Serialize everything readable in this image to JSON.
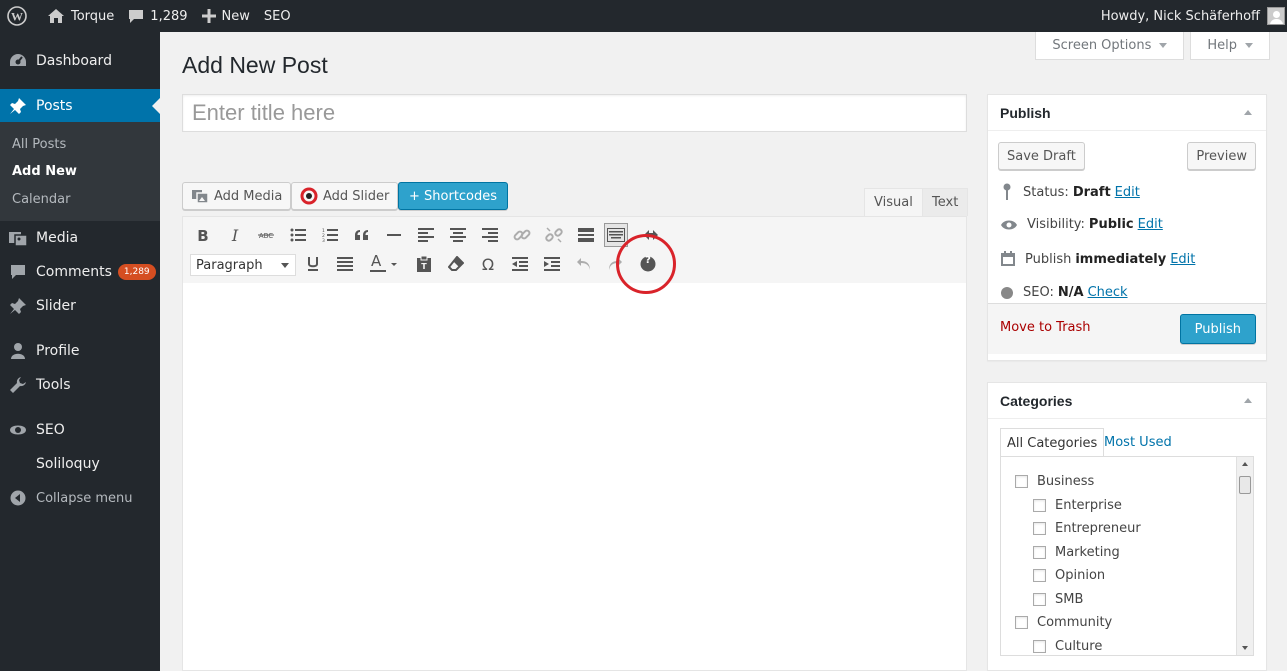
{
  "admin_bar": {
    "site_name": "Torque",
    "comments_count": "1,289",
    "new_label": "New",
    "seo_label": "SEO",
    "greeting": "Howdy, Nick Schäferhoff"
  },
  "sidebar": {
    "dashboard": "Dashboard",
    "posts": "Posts",
    "submenu": [
      "All Posts",
      "Add New",
      "Calendar"
    ],
    "media": "Media",
    "comments": "Comments",
    "comments_badge": "1,289",
    "slider": "Slider",
    "profile": "Profile",
    "tools": "Tools",
    "seo": "SEO",
    "soliloquy": "Soliloquy",
    "collapse": "Collapse menu"
  },
  "screen_tabs": {
    "screen_options": "Screen Options",
    "help": "Help"
  },
  "page_title": "Add New Post",
  "title_input": {
    "placeholder": "Enter title here",
    "value": ""
  },
  "editor": {
    "add_media": "Add Media",
    "add_slider": "Add Slider",
    "shortcodes": "+ Shortcodes",
    "tab_visual": "Visual",
    "tab_text": "Text",
    "format_select": "Paragraph",
    "text_color_glyph": "A",
    "omega_glyph": "Ω",
    "help_glyph": "?"
  },
  "publish": {
    "title": "Publish",
    "save_draft": "Save Draft",
    "preview": "Preview",
    "status_label": "Status:",
    "status_value": "Draft",
    "visibility_label": "Visibility:",
    "visibility_value": "Public",
    "publish_label": "Publish",
    "publish_value": "immediately",
    "seo_label": "SEO:",
    "seo_value": "N/A",
    "seo_check": "Check",
    "edit": "Edit",
    "move_to_trash": "Move to Trash",
    "publish_button": "Publish"
  },
  "categories": {
    "title": "Categories",
    "tab_all": "All Categories",
    "tab_most_used": "Most Used",
    "items": [
      {
        "label": "Business",
        "level": 0
      },
      {
        "label": "Enterprise",
        "level": 1
      },
      {
        "label": "Entrepreneur",
        "level": 1
      },
      {
        "label": "Marketing",
        "level": 1
      },
      {
        "label": "Opinion",
        "level": 1
      },
      {
        "label": "SMB",
        "level": 1
      },
      {
        "label": "Community",
        "level": 0
      },
      {
        "label": "Culture",
        "level": 1
      }
    ]
  },
  "colors": {
    "admin_dark": "#23282d",
    "active_blue": "#0073aa",
    "primary_button": "#2ea2cc",
    "badge_orange": "#d54e21",
    "highlight_red": "#d9232a"
  }
}
